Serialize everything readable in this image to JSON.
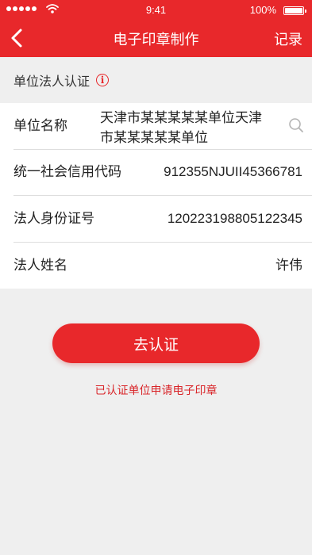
{
  "status_bar": {
    "time": "9:41",
    "battery": "100%"
  },
  "nav": {
    "title": "电子印章制作",
    "right_action": "记录"
  },
  "section": {
    "title": "单位法人认证"
  },
  "form": {
    "unit_name": {
      "label": "单位名称",
      "value_line1": "天津市某某某某某单位天津",
      "value_line2": "市某某某某某单位"
    },
    "credit_code": {
      "label": "统一社会信用代码",
      "value": "912355NJUII45366781"
    },
    "id_number": {
      "label": "法人身份证号",
      "value": "120223198805122345"
    },
    "legal_name": {
      "label": "法人姓名",
      "value": "许伟"
    }
  },
  "actions": {
    "submit_label": "去认证",
    "link_text": "已认证单位申请电子印章"
  },
  "colors": {
    "brand": "#e8282b",
    "background": "#efefef"
  }
}
